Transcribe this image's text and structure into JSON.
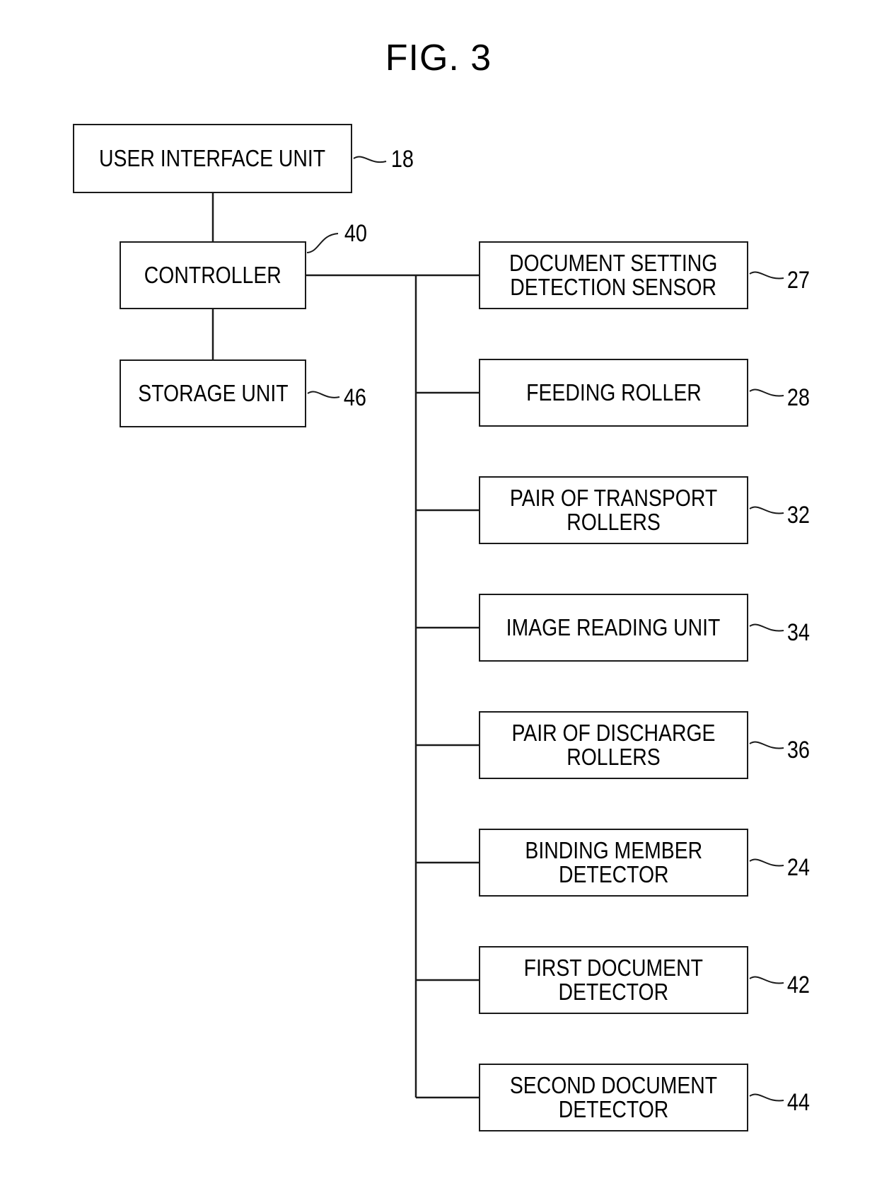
{
  "figure": {
    "title": "FIG. 3"
  },
  "blocks": {
    "user_interface": {
      "label": "USER INTERFACE UNIT",
      "ref": "18"
    },
    "controller": {
      "label": "CONTROLLER",
      "ref": "40"
    },
    "storage": {
      "label": "STORAGE UNIT",
      "ref": "46"
    }
  },
  "peripherals": [
    {
      "label": "DOCUMENT SETTING\nDETECTION SENSOR",
      "ref": "27"
    },
    {
      "label": "FEEDING ROLLER",
      "ref": "28"
    },
    {
      "label": "PAIR OF TRANSPORT\nROLLERS",
      "ref": "32"
    },
    {
      "label": "IMAGE READING UNIT",
      "ref": "34"
    },
    {
      "label": "PAIR OF DISCHARGE\nROLLERS",
      "ref": "36"
    },
    {
      "label": "BINDING MEMBER\nDETECTOR",
      "ref": "24"
    },
    {
      "label": "FIRST DOCUMENT\nDETECTOR",
      "ref": "42"
    },
    {
      "label": "SECOND DOCUMENT\nDETECTOR",
      "ref": "44"
    }
  ],
  "connections": [
    {
      "from": "user_interface",
      "to": "controller"
    },
    {
      "from": "controller",
      "to": "storage"
    },
    {
      "from": "controller",
      "to": "peripheral_bus"
    }
  ]
}
